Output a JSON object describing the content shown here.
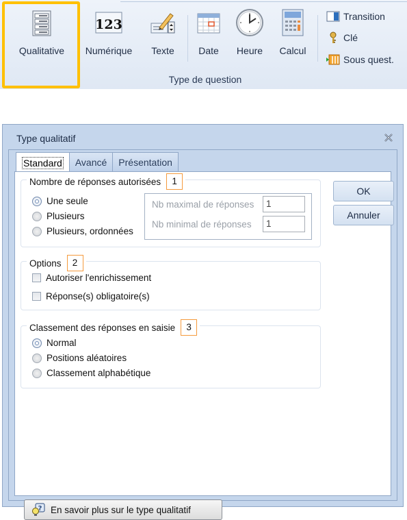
{
  "ribbon": {
    "buttons": [
      {
        "id": "qualitative",
        "label": "Qualitative",
        "icon": "list-form-icon",
        "highlighted": true
      },
      {
        "id": "numerique",
        "label": "Numérique",
        "icon": "numeric-123-icon"
      },
      {
        "id": "texte",
        "label": "Texte",
        "icon": "text-pencil-icon"
      },
      {
        "id": "date",
        "label": "Date",
        "icon": "calendar-icon"
      },
      {
        "id": "heure",
        "label": "Heure",
        "icon": "clock-icon"
      },
      {
        "id": "calcul",
        "label": "Calcul",
        "icon": "calculator-icon"
      }
    ],
    "small_buttons": [
      {
        "id": "transition",
        "label": "Transition",
        "icon": "transition-icon"
      },
      {
        "id": "cle",
        "label": "Clé",
        "icon": "key-icon"
      },
      {
        "id": "sous_quest",
        "label": "Sous quest.",
        "icon": "sub-question-icon"
      }
    ],
    "group_label": "Type de question",
    "highlight_color": "#ffc000"
  },
  "dialog": {
    "title": "Type qualitatif",
    "close_icon": "close-icon",
    "tabs": [
      {
        "label": "Standard",
        "active": true
      },
      {
        "label": "Avancé",
        "active": false
      },
      {
        "label": "Présentation",
        "active": false
      }
    ],
    "group1": {
      "title": "Nombre de réponses autorisées",
      "badge": "1",
      "options": [
        {
          "label": "Une seule",
          "selected": true
        },
        {
          "label": "Plusieurs",
          "selected": false
        },
        {
          "label": "Plusieurs, ordonnées",
          "selected": false
        }
      ],
      "max_label": "Nb maximal de réponses",
      "max_value": "1",
      "min_label": "Nb minimal de réponses",
      "min_value": "1"
    },
    "group2": {
      "title": "Options",
      "badge": "2",
      "checkboxes": [
        {
          "label": "Autoriser l'enrichissement",
          "checked": false
        },
        {
          "label": "Réponse(s) obligatoire(s)",
          "checked": false
        }
      ]
    },
    "group3": {
      "title": "Classement des réponses en saisie",
      "badge": "3",
      "options": [
        {
          "label": "Normal",
          "selected": true
        },
        {
          "label": "Positions aléatoires",
          "selected": false
        },
        {
          "label": "Classement alphabétique",
          "selected": false
        }
      ]
    },
    "ok_label": "OK",
    "cancel_label": "Annuler",
    "help_label": "En savoir plus sur le type qualitatif",
    "badge_color": "#f59a3c"
  }
}
